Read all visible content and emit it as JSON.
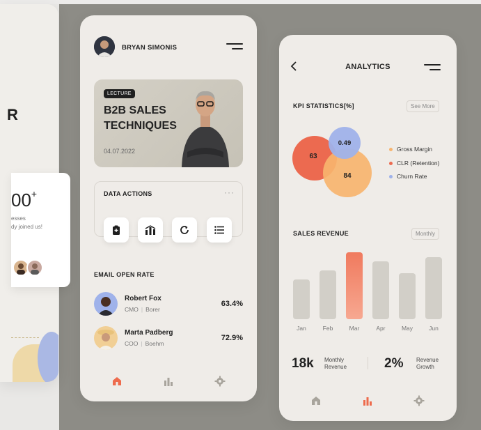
{
  "left_card": {
    "r_letter": "R",
    "big_number": "00",
    "big_sup": "+",
    "sub_line1": "esses",
    "sub_line2": "dy joined us!"
  },
  "profile": {
    "name": "BRYAN SIMONIS"
  },
  "lecture": {
    "badge": "LECTURE",
    "title_line1": "B2B SALES",
    "title_line2": "TECHNIQUES",
    "date": "04.07.2022"
  },
  "data_actions": {
    "title": "DATA ACTIONS",
    "more": "···"
  },
  "email_open_rate": {
    "title": "EMAIL OPEN RATE",
    "rows": [
      {
        "name": "Robert Fox",
        "role": "CMO",
        "company": "Borer",
        "pct": "63.4%"
      },
      {
        "name": "Marta Padberg",
        "role": "COO",
        "company": "Boehm",
        "pct": "72.9%"
      }
    ]
  },
  "analytics": {
    "title": "ANALYTICS",
    "kpi_title": "KPI STATISTICS[%]",
    "see_more": "See More",
    "bubbles": {
      "gross_margin": "84",
      "clr": "63",
      "churn": "0.49"
    },
    "legend": [
      {
        "label": "Gross Margin",
        "color": "#f7b46e"
      },
      {
        "label": "CLR (Retention)",
        "color": "#ec6a50"
      },
      {
        "label": "Churn Rate",
        "color": "#9fb2ea"
      }
    ],
    "sales_title": "SALES REVENUE",
    "period": "Monthly",
    "stat1_value": "18k",
    "stat1_label1": "Monthly",
    "stat1_label2": "Revenue",
    "stat2_value": "2%",
    "stat2_label1": "Revenue",
    "stat2_label2": "Growth"
  },
  "chart_data": {
    "type": "bar",
    "categories": [
      "Jan",
      "Feb",
      "Mar",
      "Apr",
      "May",
      "Jun"
    ],
    "values": [
      57,
      70,
      96,
      83,
      66,
      89
    ],
    "highlight_index": 2,
    "title": "SALES REVENUE",
    "xlabel": "",
    "ylabel": "",
    "ylim": [
      0,
      100
    ],
    "grid": false
  },
  "colors": {
    "accent": "#ee6b4d",
    "dark": "#1f1f1f",
    "bar": "#d2cfc8"
  }
}
